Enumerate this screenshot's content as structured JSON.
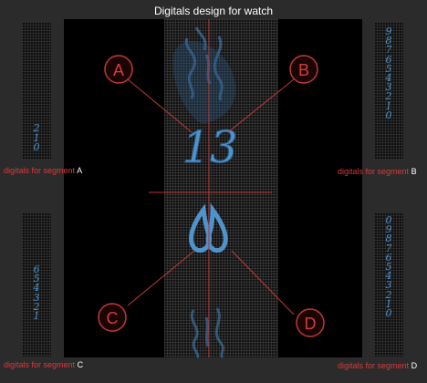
{
  "title": "Digitals design for watch",
  "callouts": [
    {
      "letter": "A"
    },
    {
      "letter": "B"
    },
    {
      "letter": "C"
    },
    {
      "letter": "D"
    }
  ],
  "center_numbers": {
    "hours": "13"
  },
  "strips": {
    "a": {
      "digits": [
        "2",
        "1",
        "0"
      ]
    },
    "b": {
      "digits": [
        "9",
        "8",
        "7",
        "6",
        "5",
        "4",
        "3",
        "2",
        "1",
        "0"
      ]
    },
    "c": {
      "digits": [
        "6",
        "5",
        "4",
        "3",
        "2",
        "1"
      ]
    },
    "d": {
      "digits": [
        "0",
        "9",
        "8",
        "7",
        "6",
        "5",
        "4",
        "3",
        "2",
        "1",
        "0"
      ]
    }
  },
  "captions": {
    "a": {
      "text": "digitals for segment",
      "letter": "A"
    },
    "b": {
      "text": "digitals for segment",
      "letter": "B"
    },
    "c": {
      "text": "digitals for segment",
      "letter": "C"
    },
    "d": {
      "text": "digitals for segment",
      "letter": "D"
    }
  },
  "colors": {
    "accent_red": "#d83a3a",
    "digit_blue": "#4f93cc",
    "background": "#2b2b2b",
    "panel": "#000000"
  }
}
